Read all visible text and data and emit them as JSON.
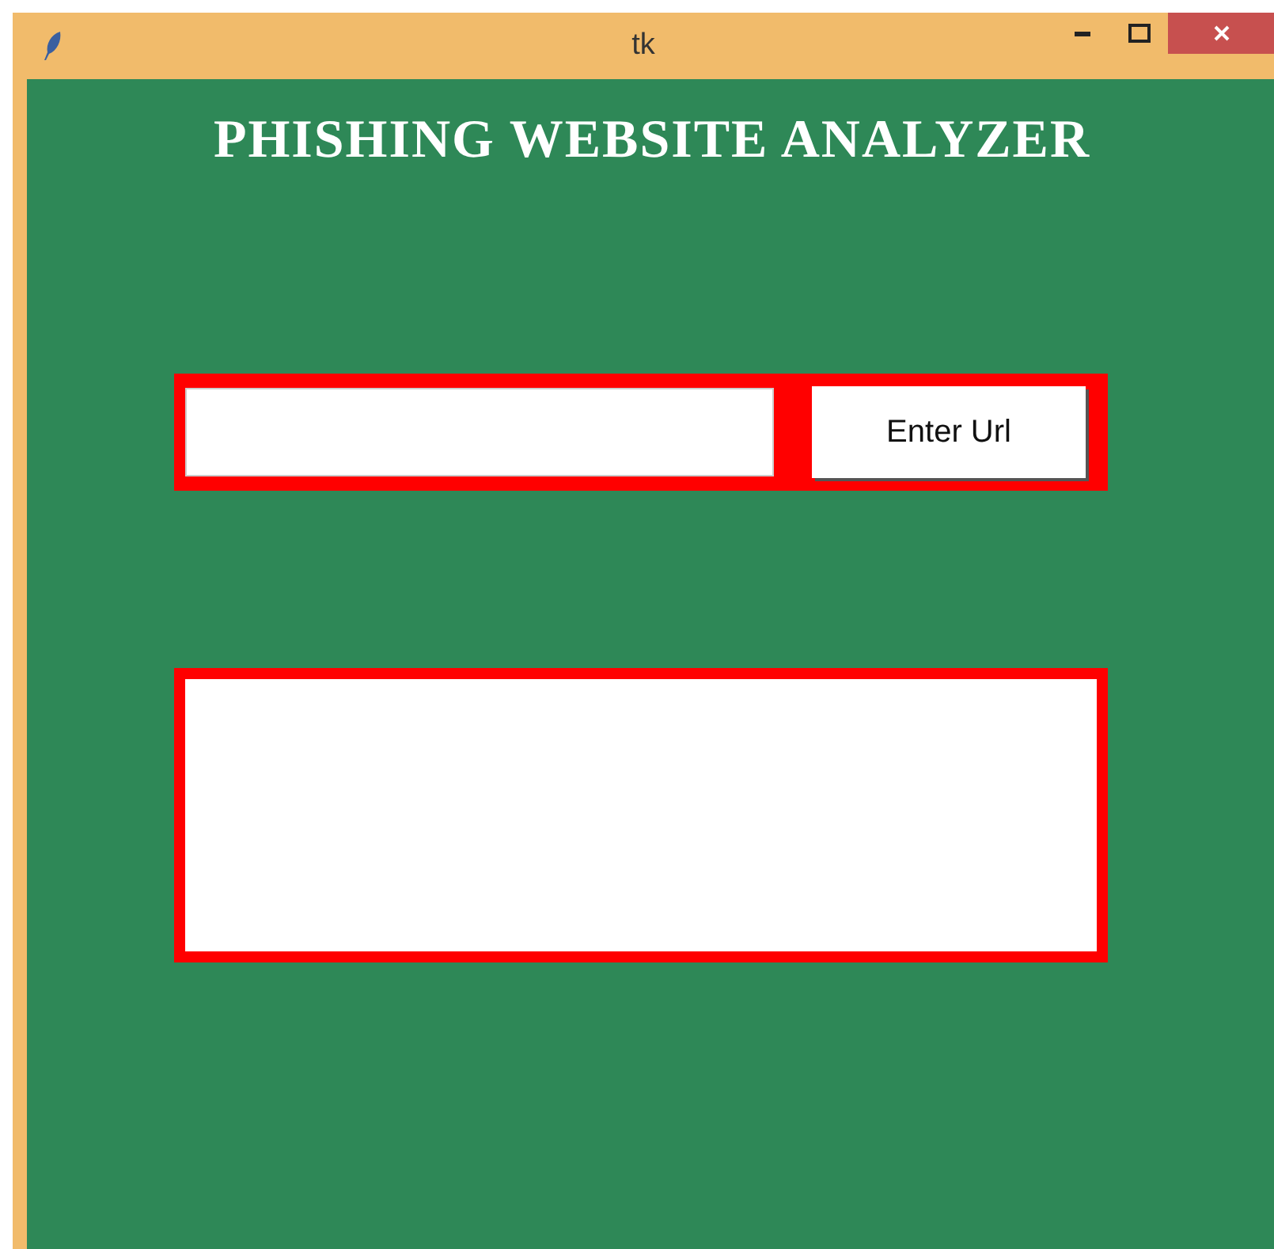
{
  "window": {
    "title": "tk"
  },
  "heading": "PHISHING WEBSITE ANALYZER",
  "enter_button": {
    "label": "Enter Url"
  }
}
